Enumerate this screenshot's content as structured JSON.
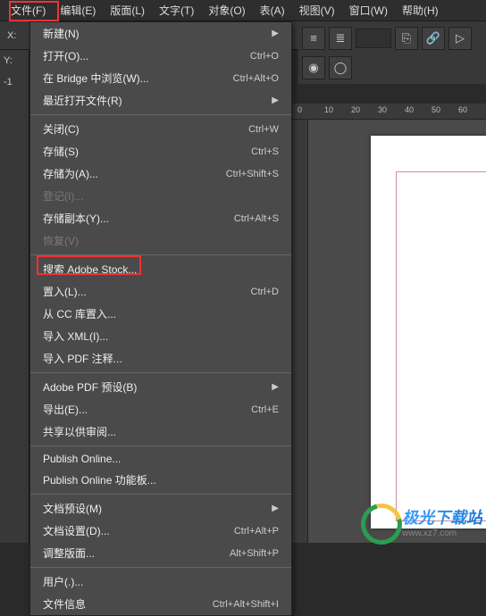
{
  "menubar": {
    "items": [
      {
        "label": "文件(F)"
      },
      {
        "label": "编辑(E)"
      },
      {
        "label": "版面(L)"
      },
      {
        "label": "文字(T)"
      },
      {
        "label": "对象(O)"
      },
      {
        "label": "表(A)"
      },
      {
        "label": "视图(V)"
      },
      {
        "label": "窗口(W)"
      },
      {
        "label": "帮助(H)"
      }
    ]
  },
  "coords": {
    "x_label": "X:",
    "y_label": "Y:"
  },
  "left_tools": {
    "dash": "-1"
  },
  "dropdown": {
    "groups": [
      [
        {
          "label": "新建(N)",
          "shortcut": "",
          "arrow": true,
          "disabled": false
        },
        {
          "label": "打开(O)...",
          "shortcut": "Ctrl+O",
          "arrow": false,
          "disabled": false
        },
        {
          "label": "在 Bridge 中浏览(W)...",
          "shortcut": "Ctrl+Alt+O",
          "arrow": false,
          "disabled": false
        },
        {
          "label": "最近打开文件(R)",
          "shortcut": "",
          "arrow": true,
          "disabled": false
        }
      ],
      [
        {
          "label": "关闭(C)",
          "shortcut": "Ctrl+W",
          "arrow": false,
          "disabled": false
        },
        {
          "label": "存储(S)",
          "shortcut": "Ctrl+S",
          "arrow": false,
          "disabled": false
        },
        {
          "label": "存储为(A)...",
          "shortcut": "Ctrl+Shift+S",
          "arrow": false,
          "disabled": false
        },
        {
          "label": "登记(I)...",
          "shortcut": "",
          "arrow": false,
          "disabled": true
        },
        {
          "label": "存储副本(Y)...",
          "shortcut": "Ctrl+Alt+S",
          "arrow": false,
          "disabled": false
        },
        {
          "label": "恢复(V)",
          "shortcut": "",
          "arrow": false,
          "disabled": true
        }
      ],
      [
        {
          "label": "搜索 Adobe Stock...",
          "shortcut": "",
          "arrow": false,
          "disabled": false
        },
        {
          "label": "置入(L)...",
          "shortcut": "Ctrl+D",
          "arrow": false,
          "disabled": false
        },
        {
          "label": "从 CC 库置入...",
          "shortcut": "",
          "arrow": false,
          "disabled": false
        },
        {
          "label": "导入 XML(I)...",
          "shortcut": "",
          "arrow": false,
          "disabled": false
        },
        {
          "label": "导入 PDF 注释...",
          "shortcut": "",
          "arrow": false,
          "disabled": false
        }
      ],
      [
        {
          "label": "Adobe PDF 预设(B)",
          "shortcut": "",
          "arrow": true,
          "disabled": false
        },
        {
          "label": "导出(E)...",
          "shortcut": "Ctrl+E",
          "arrow": false,
          "disabled": false
        },
        {
          "label": "共享以供审阅...",
          "shortcut": "",
          "arrow": false,
          "disabled": false
        }
      ],
      [
        {
          "label": "Publish Online...",
          "shortcut": "",
          "arrow": false,
          "disabled": false
        },
        {
          "label": "Publish Online 功能板...",
          "shortcut": "",
          "arrow": false,
          "disabled": false
        }
      ],
      [
        {
          "label": "文档预设(M)",
          "shortcut": "",
          "arrow": true,
          "disabled": false
        },
        {
          "label": "文档设置(D)...",
          "shortcut": "Ctrl+Alt+P",
          "arrow": false,
          "disabled": false
        },
        {
          "label": "调整版面...",
          "shortcut": "Alt+Shift+P",
          "arrow": false,
          "disabled": false
        }
      ],
      [
        {
          "label": "用户(.)...",
          "shortcut": "",
          "arrow": false,
          "disabled": false
        },
        {
          "label": "文件信息",
          "shortcut": "Ctrl+Alt+Shift+I",
          "arrow": false,
          "disabled": false
        }
      ]
    ]
  },
  "ruler": {
    "ticks": [
      "0",
      "10",
      "20",
      "30",
      "40",
      "50",
      "60"
    ]
  },
  "watermark": {
    "brand": "极光下载站",
    "url": "www.xz7.com"
  }
}
